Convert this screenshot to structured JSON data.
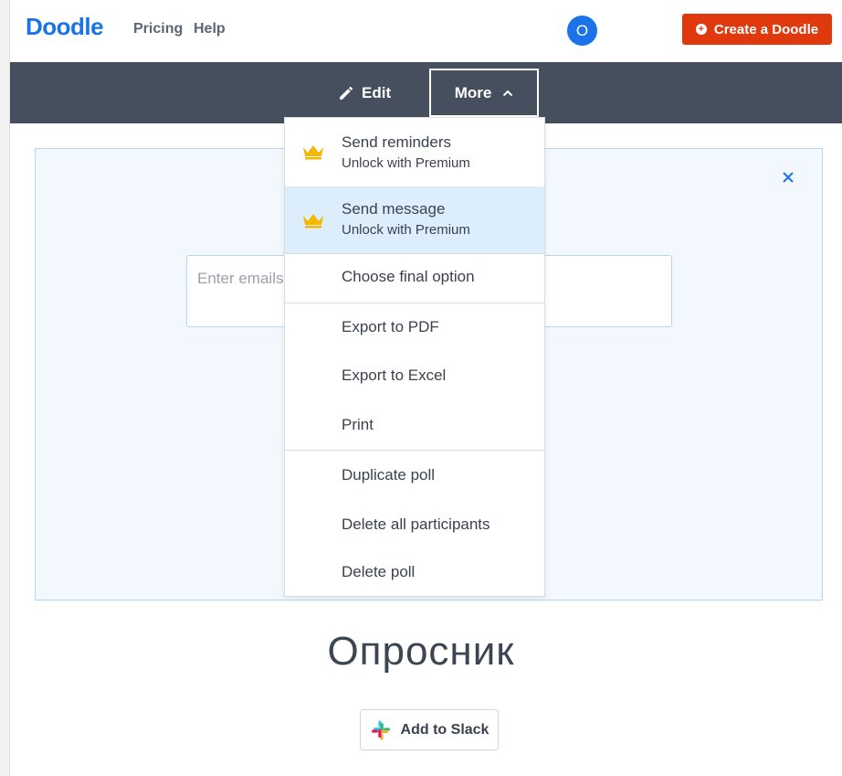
{
  "header": {
    "logo": "Doodle",
    "nav": {
      "pricing": "Pricing",
      "help": "Help"
    },
    "avatar_initial": "O",
    "create_label": "Create a Doodle"
  },
  "toolbar": {
    "edit_label": "Edit",
    "more_label": "More"
  },
  "invite": {
    "email_placeholder": "Enter emails"
  },
  "more_menu": {
    "send_reminders": {
      "label": "Send reminders",
      "sub": "Unlock with Premium"
    },
    "send_message": {
      "label": "Send message",
      "sub": "Unlock with Premium"
    },
    "choose_final": "Choose final option",
    "export_pdf": "Export to PDF",
    "export_excel": "Export to Excel",
    "print": "Print",
    "duplicate": "Duplicate poll",
    "delete_participants": "Delete all participants",
    "delete_poll": "Delete poll"
  },
  "poll": {
    "title": "Опросник"
  },
  "slack": {
    "label": "Add to Slack"
  },
  "colors": {
    "brand": "#1a73e8",
    "create": "#e0390e",
    "toolbar": "#454f5e",
    "highlight": "#dcedfb",
    "crown": "#f5b800"
  },
  "icons": [
    "pencil-icon",
    "chevron-up-icon",
    "crown-icon",
    "close-icon",
    "plus-circle-icon",
    "slack-icon"
  ]
}
